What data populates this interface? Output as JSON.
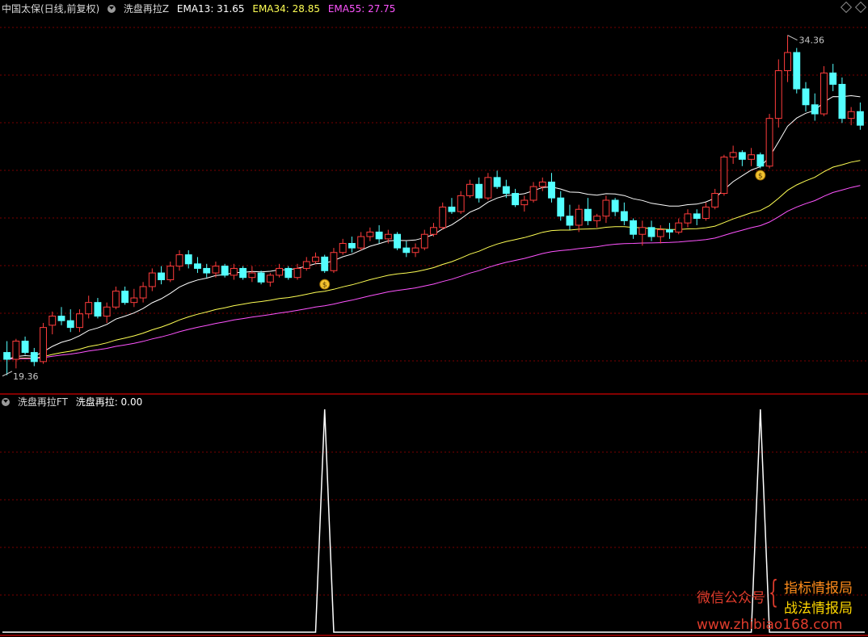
{
  "header": {
    "security": "中国太保(日线,前复权)",
    "indicator_name": "洗盘再拉Z",
    "ema13_label": "EMA13: 31.65",
    "ema34_label": "EMA34: 28.85",
    "ema55_label": "EMA55: 27.75"
  },
  "sub_header": {
    "indicator_name": "洗盘再拉FT",
    "value_label": "洗盘再拉: 0.00"
  },
  "annotations": {
    "high": "34.36",
    "low": "19.36"
  },
  "watermark": {
    "wechat": "微信公众号",
    "line1": "指标情报局",
    "line2": "战法情报局",
    "url": "www.zhibiao168.com"
  },
  "colors": {
    "up": "#ff3c3c",
    "down": "#54ffff",
    "ema13": "#ffffff",
    "ema34": "#ffff54",
    "ema55": "#ff54ff",
    "grid": "#7a0000",
    "separator": "#b00000",
    "signal": "#ffffff",
    "wechat": "#e03c2c",
    "wm_line1": "#ff8c1a",
    "wm_line2": "#ffd700"
  },
  "icons": {
    "signal_marker": "money-bag-icon",
    "collapse": "circle-chevron-icon",
    "settings": "diamond-icon"
  },
  "chart_data": [
    {
      "type": "candlestick",
      "title": "中国太保(日线,前复权)",
      "ylim": [
        19.0,
        35.2
      ],
      "high_marker": 34.36,
      "low_marker": 19.36,
      "ohlc": [
        [
          20.4,
          20.9,
          19.4,
          20.1
        ],
        [
          20.1,
          21.0,
          19.7,
          20.9
        ],
        [
          20.9,
          21.1,
          20.3,
          20.4
        ],
        [
          20.4,
          20.6,
          19.8,
          20.0
        ],
        [
          20.0,
          21.7,
          19.9,
          21.5
        ],
        [
          21.6,
          22.2,
          21.2,
          22.0
        ],
        [
          22.0,
          22.4,
          21.6,
          21.8
        ],
        [
          21.8,
          22.3,
          21.3,
          21.5
        ],
        [
          21.5,
          22.3,
          21.3,
          22.1
        ],
        [
          22.1,
          22.9,
          21.9,
          22.6
        ],
        [
          22.6,
          22.8,
          21.9,
          22.0
        ],
        [
          22.0,
          22.6,
          21.7,
          22.4
        ],
        [
          22.4,
          23.3,
          22.3,
          23.1
        ],
        [
          23.1,
          23.3,
          22.5,
          22.6
        ],
        [
          22.6,
          23.2,
          22.4,
          22.8
        ],
        [
          22.8,
          23.5,
          22.6,
          23.3
        ],
        [
          23.3,
          24.1,
          23.1,
          23.9
        ],
        [
          23.9,
          24.2,
          23.4,
          23.6
        ],
        [
          23.6,
          24.4,
          23.5,
          24.2
        ],
        [
          24.2,
          24.9,
          24.0,
          24.7
        ],
        [
          24.7,
          24.9,
          24.1,
          24.3
        ],
        [
          24.3,
          24.6,
          23.9,
          24.1
        ],
        [
          24.1,
          24.3,
          23.7,
          23.9
        ],
        [
          23.9,
          24.4,
          23.7,
          24.2
        ],
        [
          24.2,
          24.3,
          23.7,
          23.8
        ],
        [
          23.8,
          24.3,
          23.6,
          24.1
        ],
        [
          24.1,
          24.2,
          23.6,
          23.7
        ],
        [
          23.7,
          24.2,
          23.5,
          23.9
        ],
        [
          23.9,
          24.0,
          23.4,
          23.5
        ],
        [
          23.5,
          23.9,
          23.3,
          23.8
        ],
        [
          23.8,
          24.3,
          23.7,
          24.1
        ],
        [
          24.1,
          24.2,
          23.6,
          23.7
        ],
        [
          23.7,
          24.3,
          23.6,
          24.1
        ],
        [
          24.1,
          24.6,
          24.0,
          24.4
        ],
        [
          24.4,
          24.8,
          24.3,
          24.6
        ],
        [
          24.6,
          24.7,
          23.9,
          24.0
        ],
        [
          24.0,
          25.0,
          23.9,
          24.8
        ],
        [
          24.8,
          25.4,
          24.7,
          25.2
        ],
        [
          25.2,
          25.5,
          24.8,
          25.0
        ],
        [
          25.0,
          25.7,
          24.9,
          25.5
        ],
        [
          25.5,
          25.9,
          25.3,
          25.7
        ],
        [
          25.7,
          26.0,
          25.2,
          25.4
        ],
        [
          25.4,
          25.8,
          25.2,
          25.6
        ],
        [
          25.6,
          25.7,
          24.9,
          25.0
        ],
        [
          25.0,
          25.3,
          24.6,
          24.8
        ],
        [
          24.8,
          25.2,
          24.6,
          25.0
        ],
        [
          25.0,
          25.8,
          24.9,
          25.6
        ],
        [
          25.6,
          26.1,
          25.5,
          25.9
        ],
        [
          25.9,
          27.0,
          25.8,
          26.8
        ],
        [
          26.8,
          27.2,
          26.5,
          26.6
        ],
        [
          26.6,
          27.5,
          26.5,
          27.3
        ],
        [
          27.3,
          28.0,
          27.2,
          27.8
        ],
        [
          27.8,
          28.1,
          27.0,
          27.2
        ],
        [
          27.2,
          28.3,
          27.1,
          28.1
        ],
        [
          28.1,
          28.4,
          27.6,
          27.7
        ],
        [
          27.7,
          28.0,
          27.2,
          27.4
        ],
        [
          27.4,
          27.6,
          26.8,
          26.9
        ],
        [
          26.9,
          27.3,
          26.6,
          27.1
        ],
        [
          27.1,
          27.9,
          27.0,
          27.7
        ],
        [
          27.7,
          28.1,
          27.5,
          27.9
        ],
        [
          27.9,
          28.3,
          27.0,
          27.2
        ],
        [
          27.2,
          27.5,
          26.2,
          26.4
        ],
        [
          26.4,
          26.9,
          25.8,
          26.0
        ],
        [
          26.0,
          26.9,
          25.7,
          26.7
        ],
        [
          26.7,
          27.2,
          26.0,
          26.2
        ],
        [
          26.2,
          26.5,
          25.9,
          26.4
        ],
        [
          26.4,
          27.3,
          26.1,
          27.1
        ],
        [
          27.1,
          27.2,
          26.4,
          26.6
        ],
        [
          26.6,
          27.0,
          26.0,
          26.2
        ],
        [
          26.2,
          26.3,
          25.4,
          25.6
        ],
        [
          25.6,
          26.2,
          25.1,
          25.9
        ],
        [
          25.9,
          26.2,
          25.3,
          25.5
        ],
        [
          25.5,
          26.0,
          25.2,
          25.8
        ],
        [
          25.8,
          26.1,
          25.4,
          25.7
        ],
        [
          25.7,
          26.3,
          25.6,
          26.1
        ],
        [
          26.1,
          26.7,
          25.9,
          26.5
        ],
        [
          26.5,
          26.7,
          26.0,
          26.3
        ],
        [
          26.3,
          27.0,
          26.2,
          26.8
        ],
        [
          26.8,
          27.6,
          26.7,
          27.4
        ],
        [
          27.4,
          29.1,
          27.3,
          29.0
        ],
        [
          29.0,
          29.5,
          28.7,
          29.2
        ],
        [
          29.2,
          29.3,
          28.6,
          28.9
        ],
        [
          28.9,
          29.4,
          28.6,
          29.1
        ],
        [
          29.1,
          29.2,
          28.5,
          28.6
        ],
        [
          28.6,
          30.9,
          28.5,
          30.7
        ],
        [
          30.7,
          33.3,
          30.3,
          32.8
        ],
        [
          32.8,
          34.36,
          32.3,
          33.6
        ],
        [
          33.6,
          33.8,
          31.8,
          32.0
        ],
        [
          32.0,
          32.3,
          31.0,
          31.3
        ],
        [
          31.3,
          31.8,
          30.6,
          30.9
        ],
        [
          30.9,
          33.0,
          30.8,
          32.7
        ],
        [
          32.7,
          33.1,
          31.9,
          32.2
        ],
        [
          32.2,
          32.5,
          30.5,
          30.7
        ],
        [
          30.7,
          31.2,
          30.4,
          31.0
        ],
        [
          31.0,
          31.4,
          30.2,
          30.4
        ]
      ],
      "ema13_last": 31.65,
      "ema34_last": 28.85,
      "ema55_last": 27.75,
      "signals": [
        {
          "index": 35,
          "price": 23.4
        },
        {
          "index": 83,
          "price": 28.2
        }
      ]
    },
    {
      "type": "line",
      "title": "洗盘再拉FT",
      "series": [
        {
          "name": "洗盘再拉",
          "values_nonzero": [
            {
              "index": 35,
              "value": 1
            },
            {
              "index": 83,
              "value": 1
            }
          ]
        }
      ],
      "last_value": 0.0,
      "ylim": [
        0,
        1
      ]
    }
  ]
}
